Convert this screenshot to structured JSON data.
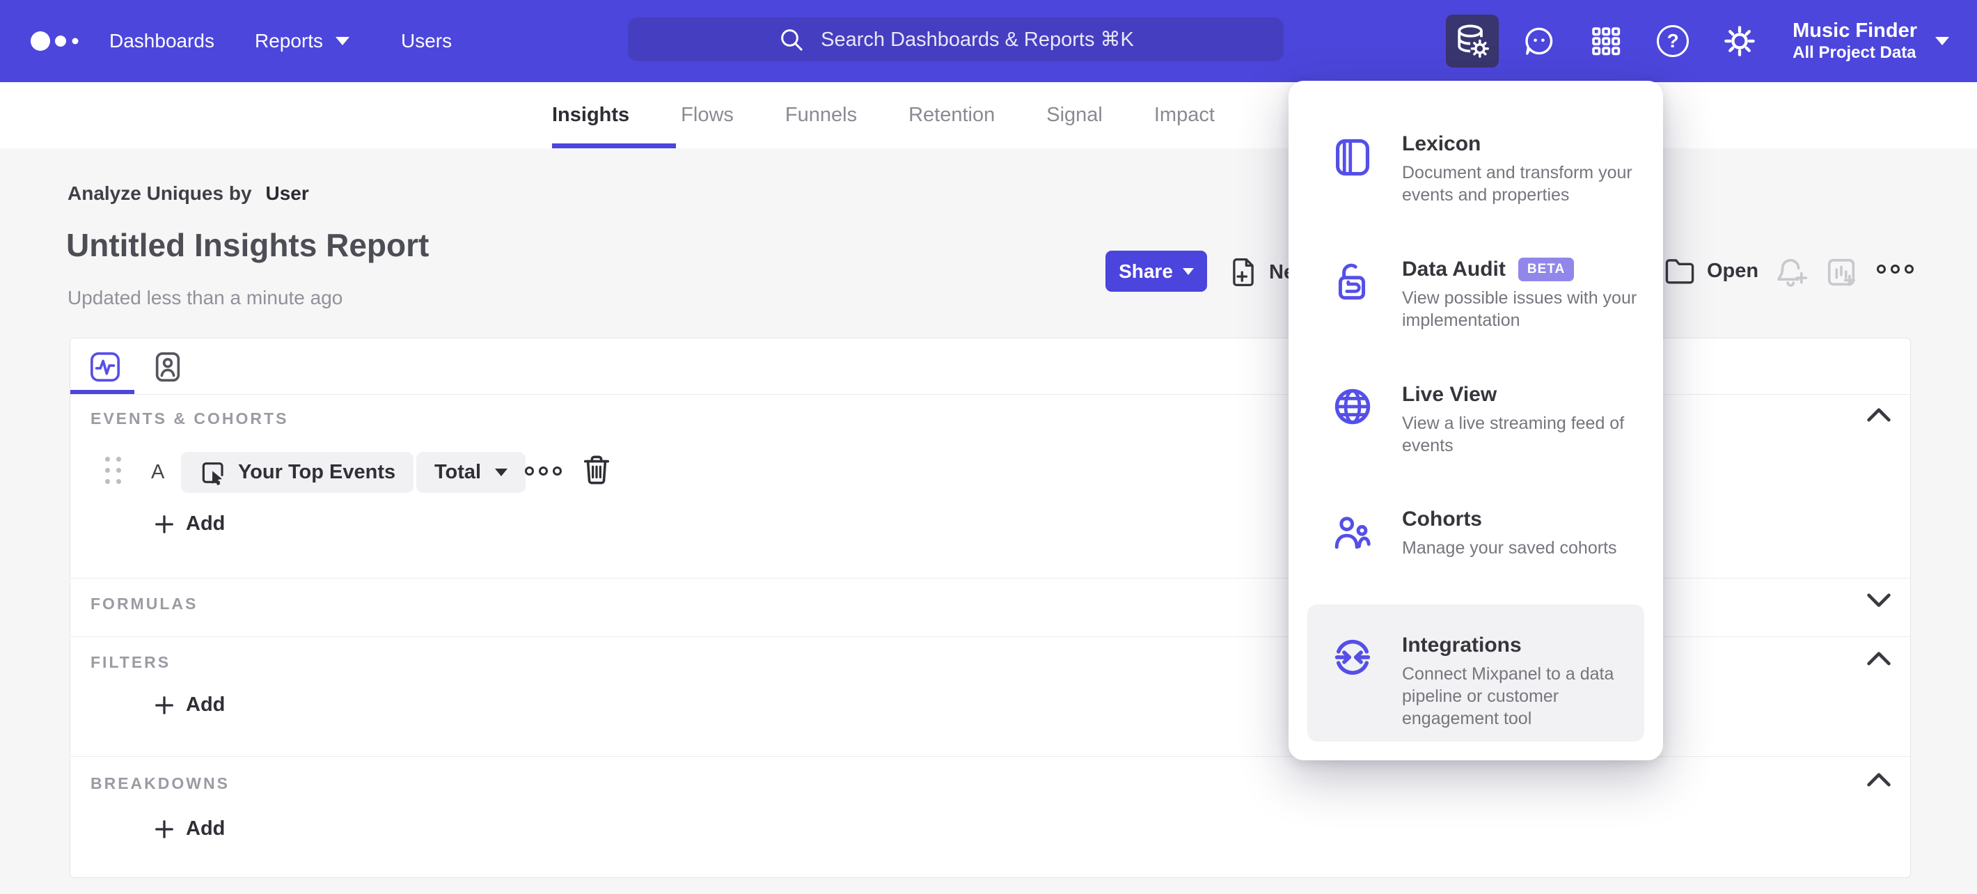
{
  "nav": {
    "items": [
      {
        "label": "Dashboards"
      },
      {
        "label": "Reports"
      },
      {
        "label": "Users"
      }
    ],
    "search": {
      "placeholder": "Search Dashboards & Reports ⌘K"
    },
    "project": {
      "name": "Music Finder",
      "scope": "All Project Data"
    }
  },
  "tabs": {
    "items": [
      {
        "label": "Insights",
        "active": true
      },
      {
        "label": "Flows"
      },
      {
        "label": "Funnels"
      },
      {
        "label": "Retention"
      },
      {
        "label": "Signal"
      },
      {
        "label": "Impact"
      }
    ]
  },
  "report": {
    "analyze_prefix": "Analyze Uniques by",
    "analyze_entity": "User",
    "title": "Untitled Insights Report",
    "updated": "Updated less than a minute ago",
    "share_label": "Share",
    "new_label": "New",
    "open_label": "Open"
  },
  "builder": {
    "sections": {
      "events": "EVENTS & COHORTS",
      "formulas": "FORMULAS",
      "filters": "FILTERS",
      "breakdowns": "BREAKDOWNS"
    },
    "event_row": {
      "letter": "A",
      "event": "Your Top Events",
      "metric": "Total"
    },
    "add_label": "Add"
  },
  "menu": {
    "items": [
      {
        "title": "Lexicon",
        "description": "Document and transform your events and properties"
      },
      {
        "title": "Data Audit",
        "badge": "BETA",
        "description": "View possible issues with your implementation"
      },
      {
        "title": "Live View",
        "description": "View a live streaming feed of events"
      },
      {
        "title": "Cohorts",
        "description": "Manage your saved cohorts"
      },
      {
        "title": "Integrations",
        "description": "Connect Mixpanel to a data pipeline or customer engagement tool"
      }
    ]
  },
  "icons": {
    "help_glyph": "?"
  },
  "colors": {
    "accent": "#4c46dc",
    "nav_search_bg": "#453ec0",
    "active_tool_bg": "#39356e",
    "beta_badge": "#9187ea",
    "page_bg": "#f6f6f7",
    "icon_purple": "#554fe8"
  }
}
